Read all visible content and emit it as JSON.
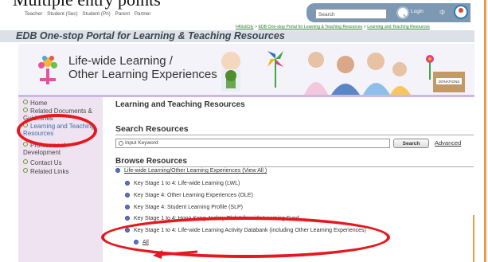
{
  "slide_title": "Multiple entry points",
  "topnav": {
    "items": [
      "Teacher",
      "Student (Sec)",
      "Student (Pri)",
      "Parent",
      "Partner"
    ],
    "search_placeholder": "Search",
    "login_label": "Login",
    "lang_label": "中"
  },
  "breadcrumb": {
    "items": [
      "HKEdCity",
      "EDB One-stop Portal for Learning & Teaching Resources",
      "Learning and Teaching Resources"
    ],
    "separator": ">"
  },
  "portal_title": "EDB One-stop Portal for Learning & Teaching Resources",
  "banner": {
    "title": "Life-wide Learning /\nOther Learning Experiences",
    "donations_label": "DONATIONS"
  },
  "sidebar": {
    "items": [
      {
        "label": "Home"
      },
      {
        "label": "Related Documents & Guidelines"
      },
      {
        "label": "Learning and Teaching Resources",
        "active": true
      },
      {
        "label": "Professional Development"
      },
      {
        "label": "Contact Us"
      },
      {
        "label": "Related Links"
      }
    ]
  },
  "main": {
    "title": "Learning and Teaching Resources",
    "search_section_title": "Search Resources",
    "keyword_value": "Input Keyword",
    "search_button": "Search",
    "advanced_link": "Advanced",
    "browse_title": "Browse Resources",
    "tree": {
      "root": "Life-wide Learning/Other Learning Experiences (View All )",
      "children": [
        "Key Stage 1 to 4: Life-wide Learning (LWL)",
        "Key Stage 4: Other Learning Experiences (OLE)",
        "Key Stage 4: Student Learning Profile (SLP)",
        "Key Stage 1 to 4: Hong Kong Jockey Club Life-wide Learning Fund",
        "Key Stage 1 to 4: Life-wide Learning Activity Databank (including Other Learning Experiences)"
      ],
      "all_link": "All"
    }
  },
  "colors": {
    "accent_red": "#e4191f",
    "sidebar_bg": "#efe3f2",
    "portal_bar": "#dbe1e7",
    "link_green": "#2b7a2b"
  }
}
